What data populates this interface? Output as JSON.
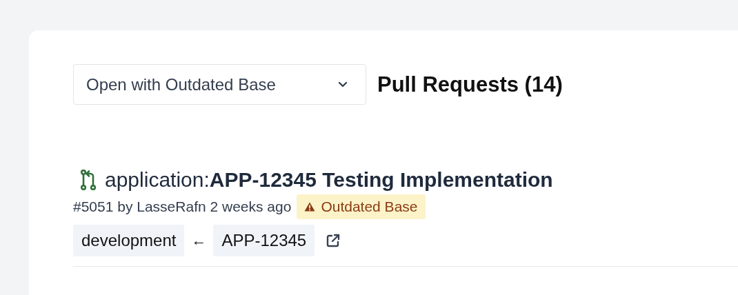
{
  "filter": {
    "value": "Open with Outdated Base"
  },
  "heading": "Pull Requests (14)",
  "pull_requests": [
    {
      "kind": "open",
      "title": "application:**APP-12345 Testing Implementation**",
      "meta": "#5051 by LasseRafn 2 weeks ago",
      "badge": {
        "kind": "warning",
        "label": "Outdated Base"
      },
      "base_branch": "development",
      "arrow": "←",
      "head_branch": "APP-12345"
    }
  ]
}
